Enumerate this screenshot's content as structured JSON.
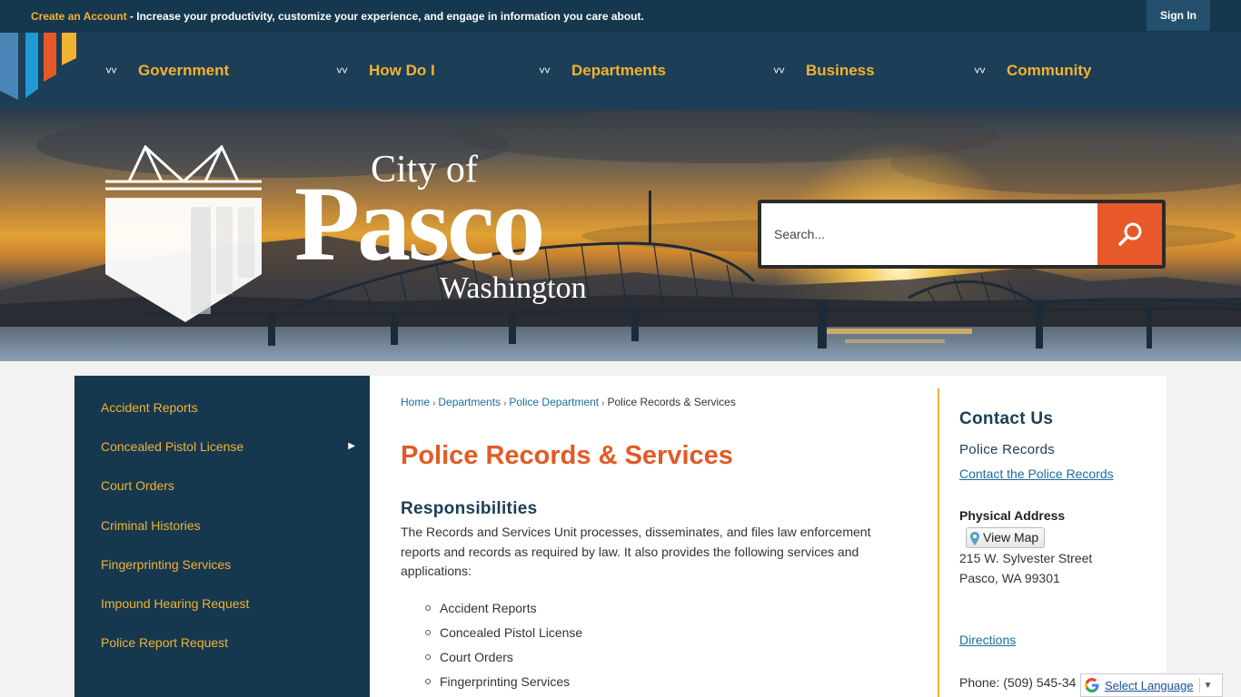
{
  "topbar": {
    "create_account": "Create an Account",
    "message": " - Increase your productivity, customize your experience, and engage in information you care about.",
    "sign_in": "Sign In"
  },
  "nav": {
    "items": [
      {
        "label": "Government"
      },
      {
        "label": "How Do I"
      },
      {
        "label": "Departments"
      },
      {
        "label": "Business"
      },
      {
        "label": "Community"
      }
    ]
  },
  "logo": {
    "line1": "City of",
    "line2": "Pasco",
    "line3": "Washington"
  },
  "search": {
    "placeholder": "Search..."
  },
  "sidebar": {
    "items": [
      {
        "label": "Accident Reports"
      },
      {
        "label": "Concealed Pistol License",
        "has_submenu": true
      },
      {
        "label": "Court Orders"
      },
      {
        "label": "Criminal Histories"
      },
      {
        "label": "Fingerprinting Services"
      },
      {
        "label": "Impound Hearing Request"
      },
      {
        "label": "Police Report Request"
      }
    ]
  },
  "breadcrumb": {
    "home": "Home",
    "departments": "Departments",
    "police": "Police Department",
    "current": "Police Records & Services"
  },
  "main": {
    "title": "Police Records & Services",
    "subheading": "Responsibilities",
    "paragraph": "The Records and Services Unit processes, disseminates, and files law enforcement reports and records as required by law. It also provides the following services and applications:",
    "services": [
      "Accident Reports",
      "Concealed Pistol License",
      "Court Orders",
      "Fingerprinting Services"
    ]
  },
  "contact": {
    "heading": "Contact Us",
    "department": "Police Records",
    "contact_link": "Contact the Police Records",
    "address_heading": "Physical Address",
    "view_map": "View Map",
    "street": "215 W. Sylvester Street",
    "city": "Pasco, WA 99301",
    "directions": "Directions",
    "phone": "Phone: (509) 545-34"
  },
  "translate": {
    "label": "Select Language"
  },
  "colors": {
    "navy": "#16384f",
    "gold": "#f2b233",
    "orange": "#e25a26",
    "link": "#1a6ea0"
  }
}
